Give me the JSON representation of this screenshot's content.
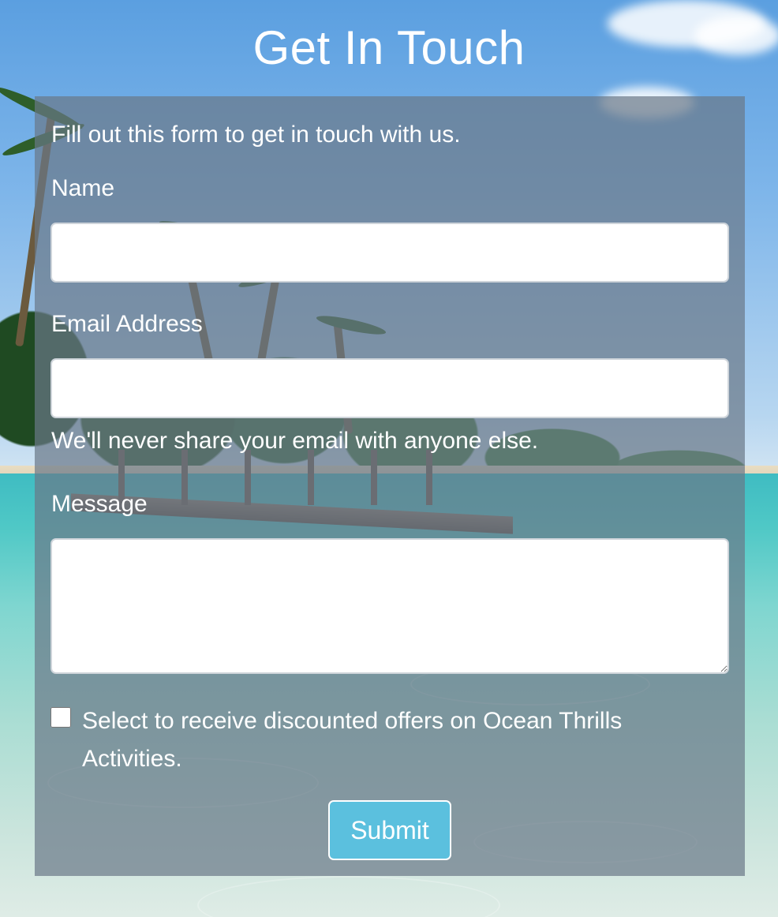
{
  "page": {
    "title": "Get In Touch"
  },
  "form": {
    "intro": "Fill out this form to get in touch with us.",
    "name_label": "Name",
    "name_value": "",
    "email_label": "Email Address",
    "email_value": "",
    "email_help": "We'll never share your email with anyone else.",
    "message_label": "Message",
    "message_value": "",
    "offers_checked": false,
    "offers_label": "Select to receive discounted offers on Ocean Thrills Activities.",
    "submit_label": "Submit"
  },
  "colors": {
    "submit_bg": "#5bc0de",
    "panel_bg": "rgba(105,120,135,0.70)",
    "text": "#ffffff",
    "input_border": "#ced4da"
  }
}
